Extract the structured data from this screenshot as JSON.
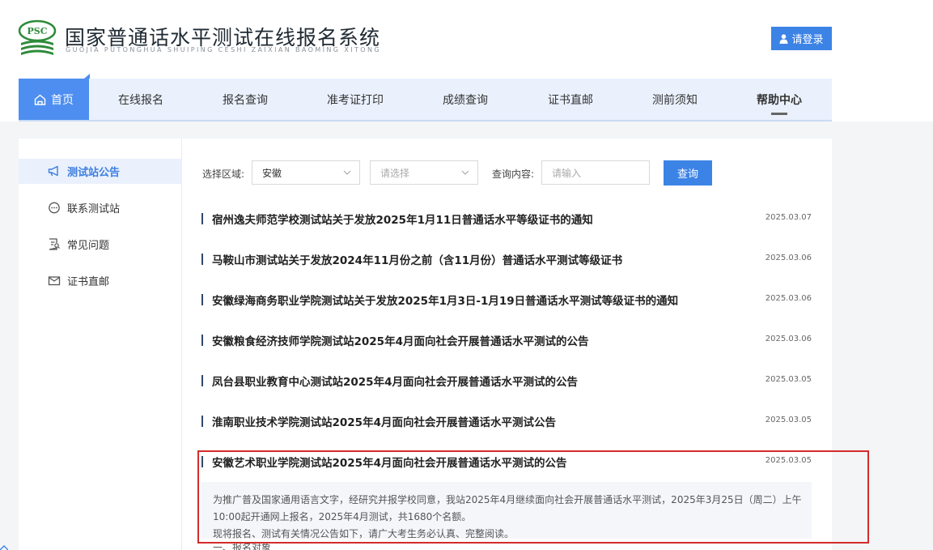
{
  "header": {
    "logo_text": "PSC",
    "title": "国家普通话水平测试在线报名系统",
    "subtitle": "GUOJIA PUTONGHUA SHUIPING CESHI ZAIXIAN BAOMING XITONG",
    "login_label": "请登录"
  },
  "nav": {
    "items": [
      {
        "label": "首页"
      },
      {
        "label": "在线报名"
      },
      {
        "label": "报名查询"
      },
      {
        "label": "准考证打印"
      },
      {
        "label": "成绩查询"
      },
      {
        "label": "证书直邮"
      },
      {
        "label": "测前须知"
      },
      {
        "label": "帮助中心"
      }
    ]
  },
  "sidebar": {
    "items": [
      {
        "label": "测试站公告",
        "icon": "megaphone-icon"
      },
      {
        "label": "联系测试站",
        "icon": "chat-icon"
      },
      {
        "label": "常见问题",
        "icon": "document-search-icon"
      },
      {
        "label": "证书直邮",
        "icon": "mail-icon"
      }
    ]
  },
  "filters": {
    "region_label": "选择区域:",
    "region_value": "安徽",
    "city_placeholder": "请选择",
    "query_label": "查询内容:",
    "query_placeholder": "请输入",
    "query_button": "查询"
  },
  "news": [
    {
      "title": "宿州逸夫师范学校测试站关于发放2025年1月11日普通话水平等级证书的通知",
      "date": "2025.03.07"
    },
    {
      "title": "马鞍山市测试站关于发放2024年11月份之前（含11月份）普通话水平测试等级证书",
      "date": "2025.03.06"
    },
    {
      "title": "安徽绿海商务职业学院测试站关于发放2025年1月3日-1月19日普通话水平测试等级证书的通知",
      "date": "2025.03.06"
    },
    {
      "title": "安徽粮食经济技师学院测试站2025年4月面向社会开展普通话水平测试的公告",
      "date": "2025.03.06"
    },
    {
      "title": "凤台县职业教育中心测试站2025年4月面向社会开展普通话水平测试的公告",
      "date": "2025.03.05"
    },
    {
      "title": "淮南职业技术学院测试站2025年4月面向社会开展普通话水平测试公告",
      "date": "2025.03.05"
    },
    {
      "title": "安徽艺术职业学院测试站2025年4月面向社会开展普通话水平测试的公告",
      "date": "2025.03.05"
    }
  ],
  "excerpt": {
    "line1": "为推广普及国家通用语言文字，经研究并报学校同意，我站2025年4月继续面向社会开展普通话水平测试，2025年3月25日（周二）上午",
    "line2": "10:00起开通网上报名，2025年4月测试，共1680个名额。",
    "line3": "现将报名、测试有关情况公告如下，请广大考生务必认真、完整阅读。",
    "next_heading": "一、报名对象"
  },
  "colors": {
    "primary": "#3c83e6",
    "nav_bg": "#eaf1fd",
    "nav_active": "#4e8ef0",
    "highlight": "#d42b2b",
    "logo_green": "#2e8b3a"
  }
}
